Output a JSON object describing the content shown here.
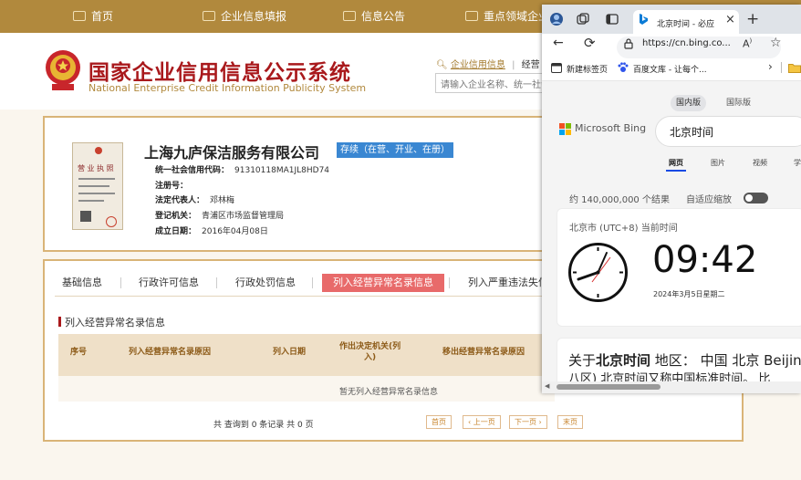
{
  "topnav": {
    "items": [
      "首页",
      "企业信息填报",
      "信息公告",
      "重点领域企业"
    ]
  },
  "header": {
    "title_cn": "国家企业信用信息公示系统",
    "title_en": "National Enterprise Credit Information Publicity System",
    "search_link_1": "企业信用信息",
    "search_link_sep": "|",
    "search_link_2": "经营",
    "search_placeholder": "请输入企业名称、统一社会"
  },
  "company": {
    "name": "上海九庐保洁服务有限公司",
    "status": "存续（在营、开业、在册）",
    "license_title": "营 业 执 照",
    "fields": [
      {
        "label": "统一社会信用代码：",
        "value": "91310118MA1JL8HD74"
      },
      {
        "label": "注册号：",
        "value": ""
      },
      {
        "label": "法定代表人：",
        "value": "邓林梅"
      },
      {
        "label": "登记机关：",
        "value": "青浦区市场监督管理局"
      },
      {
        "label": "成立日期：",
        "value": "2016年04月08日"
      }
    ]
  },
  "tabs": {
    "items": [
      "基础信息",
      "行政许可信息",
      "行政处罚信息",
      "列入经营异常名录信息",
      "列入严重违法失信"
    ],
    "active_index": 3
  },
  "section": {
    "title": "列入经营异常名录信息",
    "columns": [
      "序号",
      "列入经营异常名录原因",
      "列入日期",
      "作出决定机关(列入)",
      "移出经营异常名录原因"
    ],
    "col_line1": "作出决定机关(列",
    "col_line2": "入)",
    "empty_text": "暂无列入经营异常名录信息",
    "pagination_text": "共 查询到 0 条记录 共 0 页",
    "buttons": [
      "首页",
      "‹ 上一页",
      "下一页 ›",
      "末页"
    ]
  },
  "browser": {
    "tab_title": "北京时间 - 必应",
    "tab_close": "×",
    "new_tab": "+",
    "address": "https://cn.bing.co...",
    "reader_icon_text": "A",
    "fav_1": "新建标签页",
    "fav_2": "百度文库 - 让每个...",
    "fav_more": "›",
    "seg_1": "国内版",
    "seg_2": "国际版",
    "brand": "Microsoft Bing",
    "query": "北京时间",
    "nav": [
      "网页",
      "图片",
      "视频",
      "学"
    ],
    "results_count": "约 140,000,000 个结果",
    "safesearch": "自适应缩放",
    "clock_location": "北京市 (UTC+8) 当前时间",
    "clock_time": "09:42",
    "clock_date": "2024年3月5日星期二",
    "result_text_pre": "关于",
    "result_text_bold": "北京时间",
    "result_text_post": " 地区： 中国 北京 Beijin",
    "result_line2": "八区) 北京时间又称中国标准时间。 比"
  },
  "colors": {
    "brand_gold": "#b1893d",
    "brand_red": "#a9191c",
    "tab_active": "#e86a6a",
    "status_blue": "#3a87d2"
  }
}
